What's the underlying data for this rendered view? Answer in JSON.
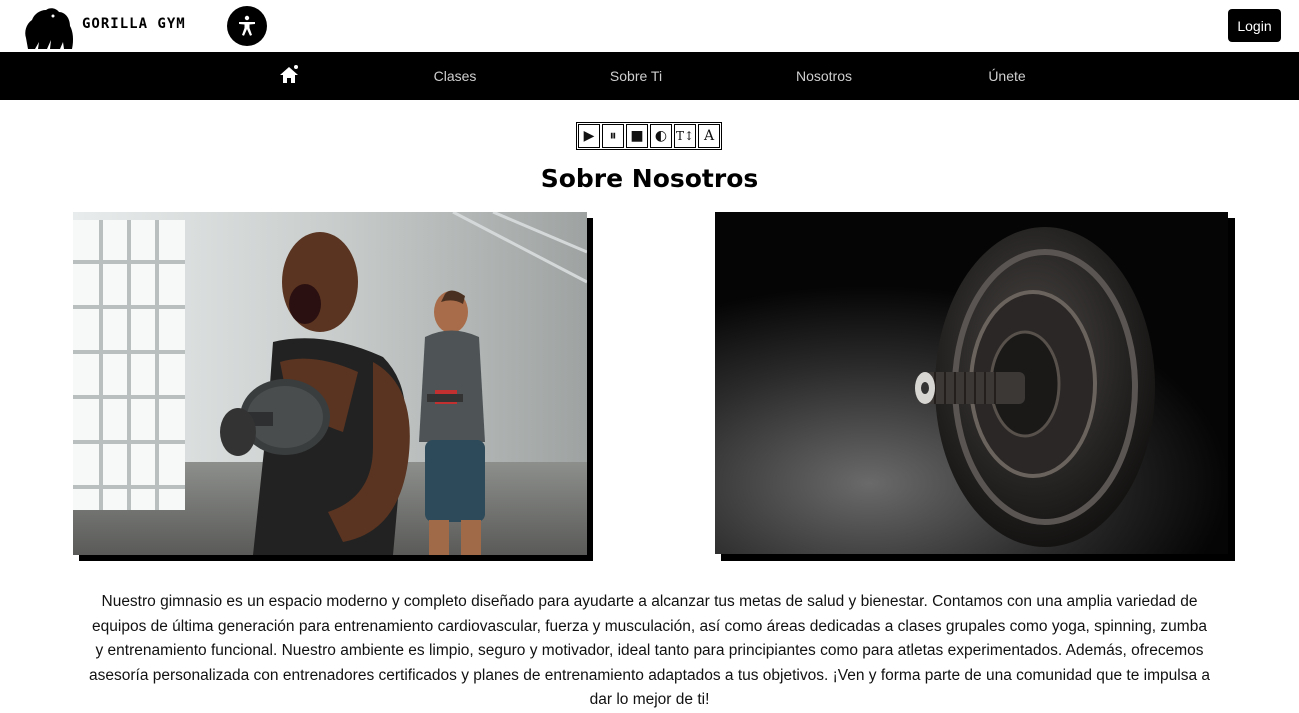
{
  "header": {
    "brand": "GORILLA GYM",
    "login_label": "Login"
  },
  "nav": {
    "items": [
      {
        "label": "Clases"
      },
      {
        "label": "Sobre Ti"
      },
      {
        "label": "Nosotros"
      },
      {
        "label": "Únete"
      }
    ]
  },
  "tts_controls": {
    "buttons": [
      {
        "icon": "play-icon",
        "glyph": "▶"
      },
      {
        "icon": "pause-icon",
        "glyph": "⏸"
      },
      {
        "icon": "stop-icon",
        "glyph": "■"
      },
      {
        "icon": "contrast-icon",
        "glyph": "◐"
      },
      {
        "icon": "text-size-icon",
        "glyph": "T↕"
      },
      {
        "icon": "font-icon",
        "glyph": "A"
      }
    ]
  },
  "main": {
    "title": "Sobre Nosotros",
    "description": "Nuestro gimnasio es un espacio moderno y completo diseñado para ayudarte a alcanzar tus metas de salud y bienestar. Contamos con una amplia variedad de equipos de última generación para entrenamiento cardiovascular, fuerza y musculación, así como áreas dedicadas a clases grupales como yoga, spinning, zumba y entrenamiento funcional. Nuestro ambiente es limpio, seguro y motivador, ideal tanto para principiantes como para atletas experimentados. Además, ofrecemos asesoría personalizada con entrenadores certificados y planes de entrenamiento adaptados a tus objetivos. ¡Ven y forma parte de una comunidad que te impulsa a dar lo mejor de ti!"
  },
  "colors": {
    "nav_bg": "#000000",
    "nav_text": "#cfcfcf",
    "accent": "#000000"
  }
}
